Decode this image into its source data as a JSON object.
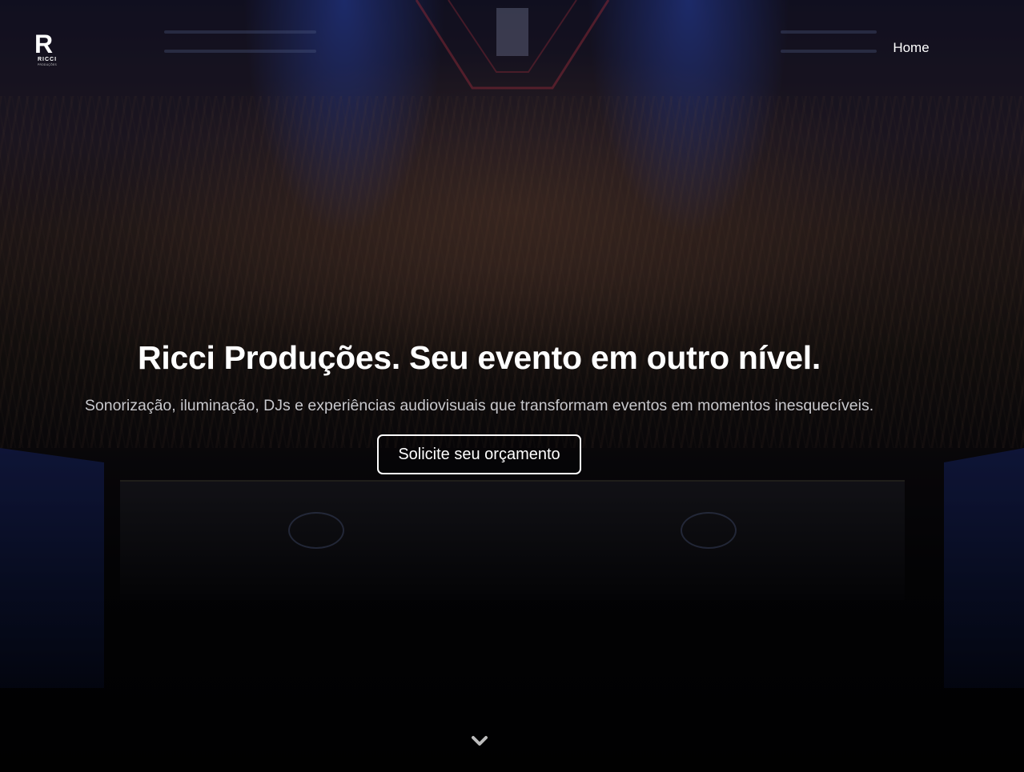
{
  "brand": {
    "logo_letter": "R",
    "logo_name": "RICCI",
    "logo_tag": "PRODUÇÕES"
  },
  "nav": {
    "home_label": "Home"
  },
  "hero": {
    "headline": "Ricci Produções. Seu evento em outro nível.",
    "subheadline": "Sonorização, iluminação, DJs e experiências audiovisuais que transformam eventos em momentos inesquecíveis.",
    "cta_label": "Solicite seu orçamento",
    "scroll_icon": "chevron-down-icon"
  },
  "colors": {
    "text": "#ffffff",
    "subtext": "#c8c8cc",
    "stage_blue": "#3c64ff"
  }
}
